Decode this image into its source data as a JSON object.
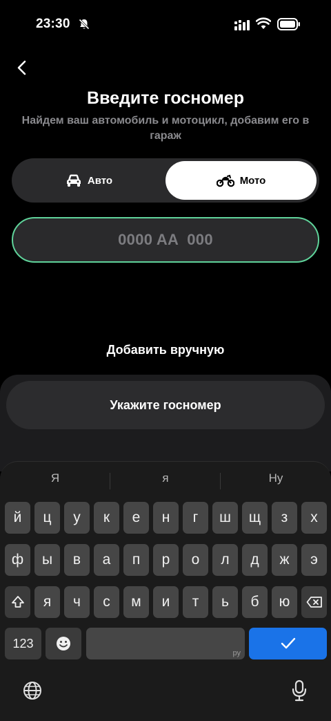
{
  "status_bar": {
    "time": "23:30"
  },
  "header": {
    "title": "Введите госномер",
    "subtitle": "Найдем ваш автомобиль и мотоцикл, добавим его в гараж"
  },
  "vehicle_toggle": {
    "auto_label": "Авто",
    "moto_label": "Мото",
    "selected": "Мото"
  },
  "plate_input": {
    "placeholder": "0000 AA  000"
  },
  "manual_link": "Добавить вручную",
  "cta": {
    "label": "Укажите госномер"
  },
  "keyboard": {
    "suggestions": [
      "Я",
      "я",
      "Ну"
    ],
    "row1": [
      "й",
      "ц",
      "у",
      "к",
      "е",
      "н",
      "г",
      "ш",
      "щ",
      "з",
      "х"
    ],
    "row2": [
      "ф",
      "ы",
      "в",
      "а",
      "п",
      "р",
      "о",
      "л",
      "д",
      "ж",
      "э"
    ],
    "row3": [
      "я",
      "ч",
      "с",
      "м",
      "и",
      "т",
      "ь",
      "б",
      "ю"
    ],
    "numbers_key": "123",
    "space_lang": "ру",
    "accent_color": "#1a73e8"
  },
  "colors": {
    "plate_border": "#5fd39a",
    "background": "#000000"
  }
}
